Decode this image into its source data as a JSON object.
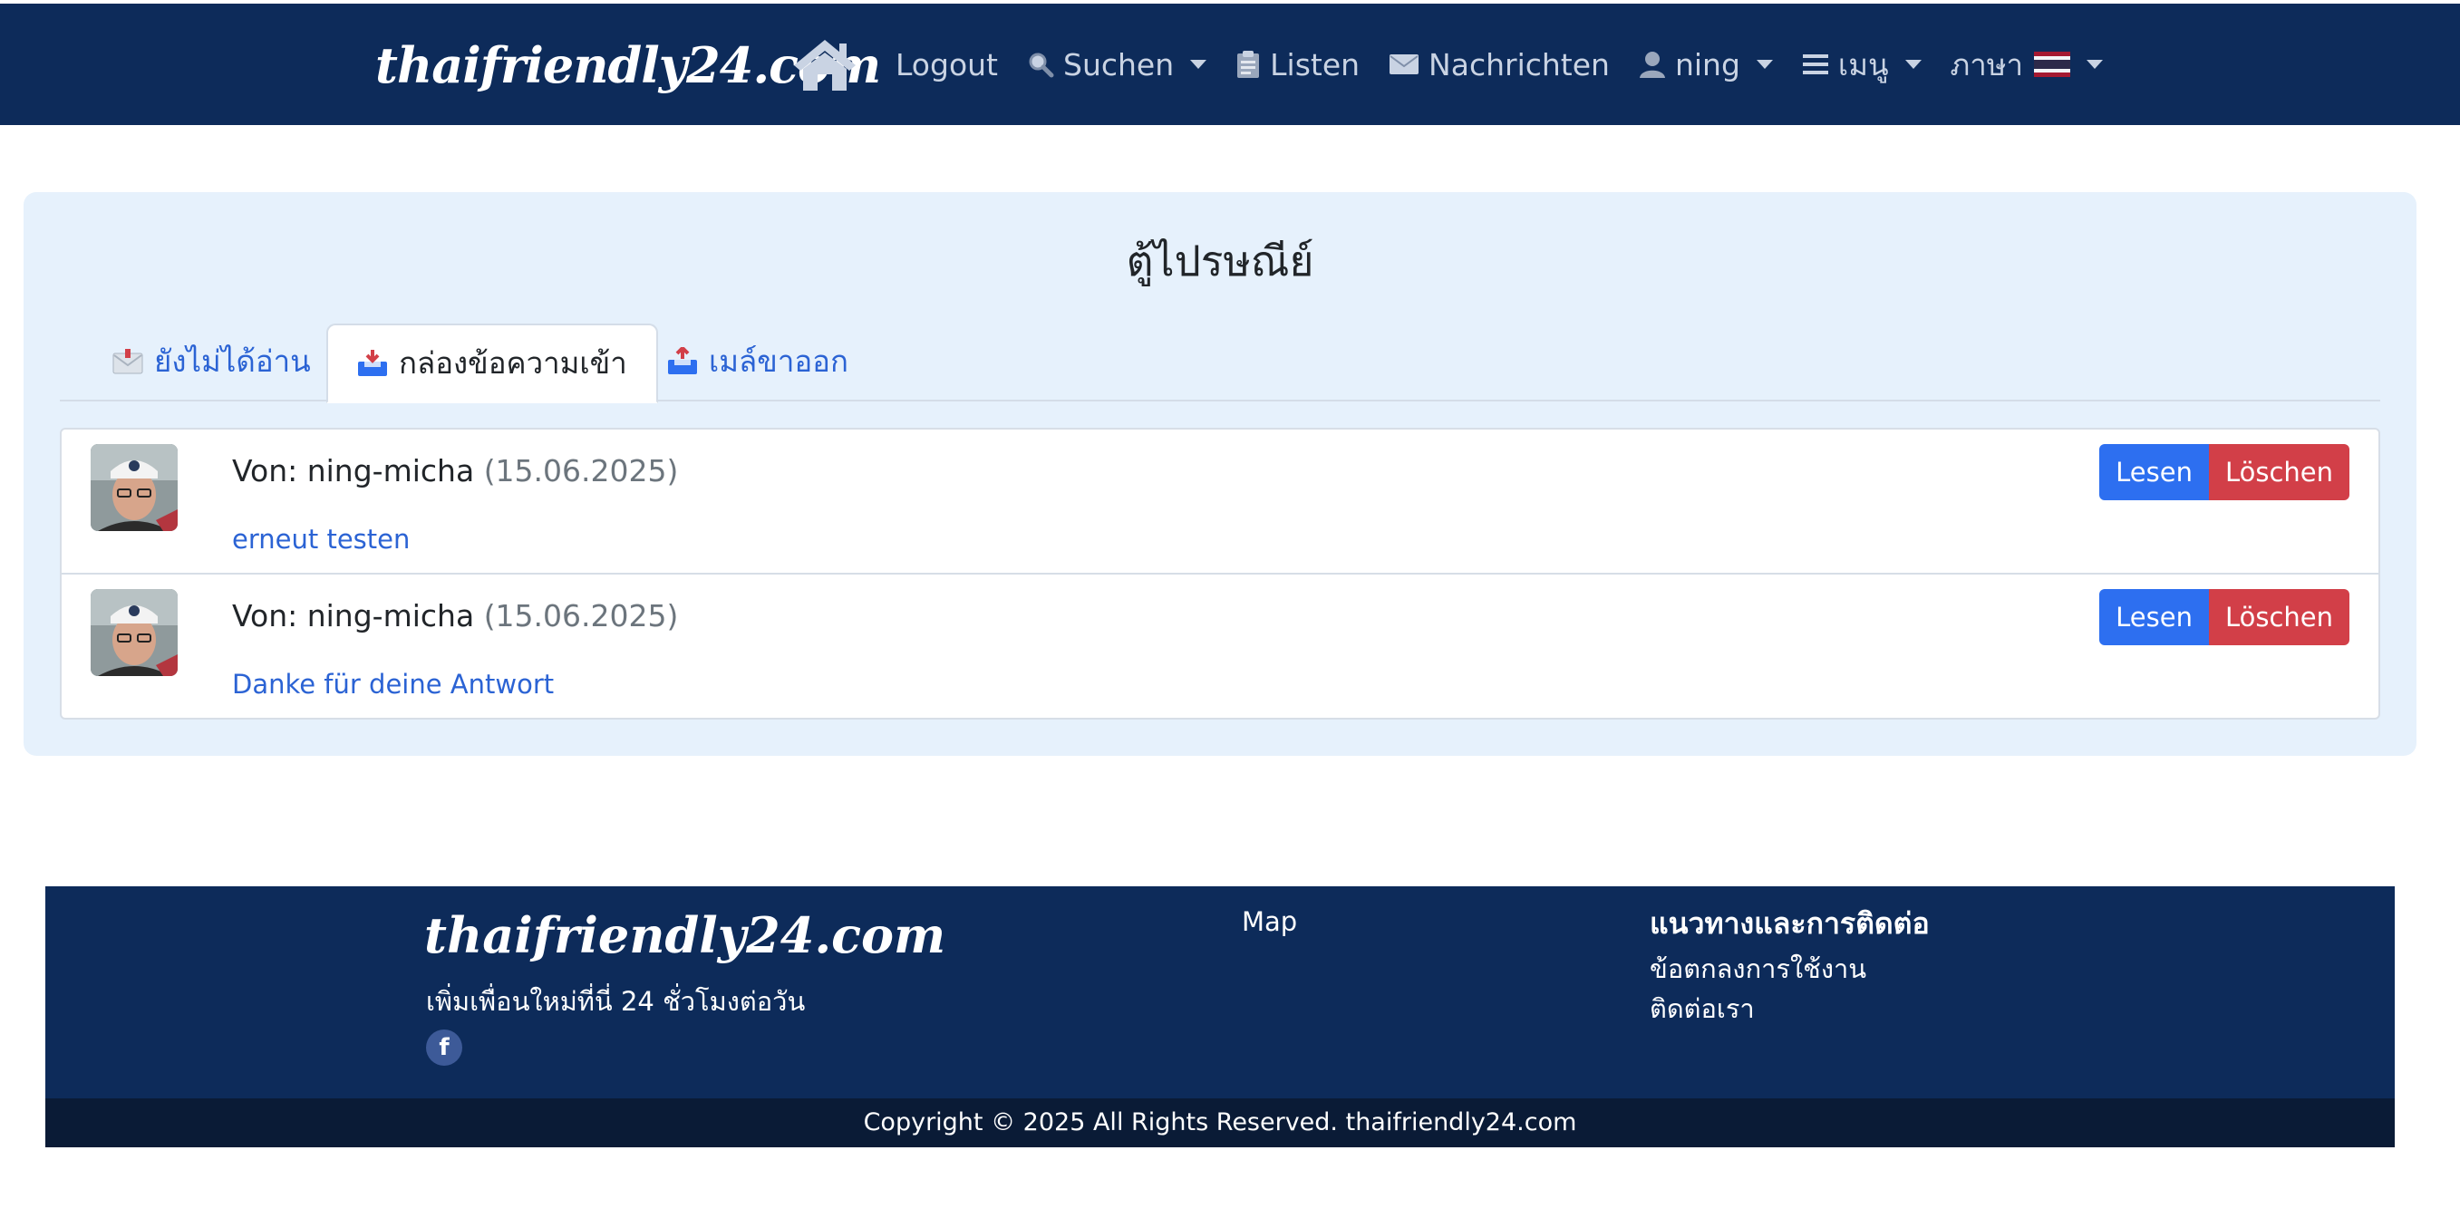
{
  "navbar": {
    "brand": "thaifriendly24.com",
    "items": [
      {
        "label": "Logout",
        "icon": "logout"
      },
      {
        "label": "Suchen",
        "icon": "search-icon",
        "dropdown": true
      },
      {
        "label": "Listen",
        "icon": "clipboard-icon"
      },
      {
        "label": "Nachrichten",
        "icon": "envelope-icon"
      },
      {
        "label": "ning",
        "icon": "user-icon",
        "dropdown": true
      },
      {
        "label": "เมนู",
        "icon": "menu-icon",
        "dropdown": true
      },
      {
        "label": "ภาษา",
        "icon": "thai-flag-icon",
        "dropdown": true
      }
    ]
  },
  "mailbox": {
    "title": "ตู้ไปรษณีย์",
    "tabs": [
      {
        "label": "ยังไม่ได้อ่าน",
        "active": false,
        "icon": "envelope-icon"
      },
      {
        "label": "กล่องข้อความเข้า",
        "active": true,
        "icon": "inbox-tray-icon"
      },
      {
        "label": "เมล์ขาออก",
        "active": false,
        "icon": "outbox-tray-icon"
      }
    ],
    "messages": [
      {
        "from_label": "Von: ning-micha",
        "date": "(15.06.2025)",
        "subject": "erneut testen",
        "read_label": "Lesen",
        "delete_label": "Löschen"
      },
      {
        "from_label": "Von: ning-micha",
        "date": "(15.06.2025)",
        "subject": "Danke für deine Antwort",
        "read_label": "Lesen",
        "delete_label": "Löschen"
      }
    ]
  },
  "footer": {
    "brand": "thaifriendly24.com",
    "tagline": "เพิ่มเพื่อนใหม่ที่นี่ 24 ชั่วโมงต่อวัน",
    "facebook": "f",
    "map_link": "Map",
    "guide_heading": "แนวทางและการติดต่อ",
    "links": [
      "ข้อตกลงการใช้งาน",
      "ติดต่อเรา"
    ],
    "copyright": "Copyright © 2025 All Rights Reserved. thaifriendly24.com"
  },
  "colors": {
    "navbar_bg": "#0d2b5a",
    "panel_bg": "#e6f1fc",
    "link": "#2b63d4",
    "read_button": "#2d6ff0",
    "delete_button": "#d23f48"
  }
}
